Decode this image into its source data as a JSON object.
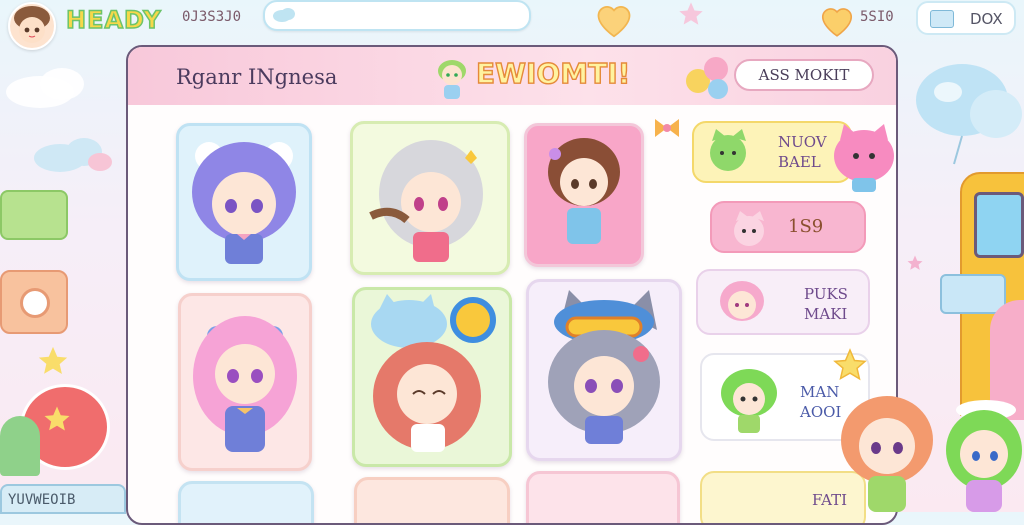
{
  "header": {
    "logo": "HEADY",
    "coins": "0J3S3J0",
    "search_value": "",
    "score": "5SI0",
    "box_label": "DOX"
  },
  "panel": {
    "title": "Rganr INgnesa",
    "banner": "EWIOMTI!",
    "add_button": "ASS MOKIT"
  },
  "sidebar_chips": [
    {
      "line1": "NUOV",
      "line2": "BAEL"
    },
    {
      "line1": "1S9",
      "line2": ""
    },
    {
      "line1": "PUKS",
      "line2": "MAKI"
    },
    {
      "line1": "MAN",
      "line2": "AOOI"
    },
    {
      "line1": "FATI",
      "line2": ""
    }
  ],
  "footer": "YUVWEOIB",
  "colors": {
    "accent_pink": "#f6a9c6",
    "accent_blue": "#a9d9f0",
    "accent_green": "#bde8a4",
    "panel_border": "#6b5a7a"
  },
  "icons": [
    "heart-icon",
    "star-icon",
    "cloud-icon",
    "camera-icon",
    "balloon-icon",
    "box-icon",
    "bow-icon"
  ]
}
